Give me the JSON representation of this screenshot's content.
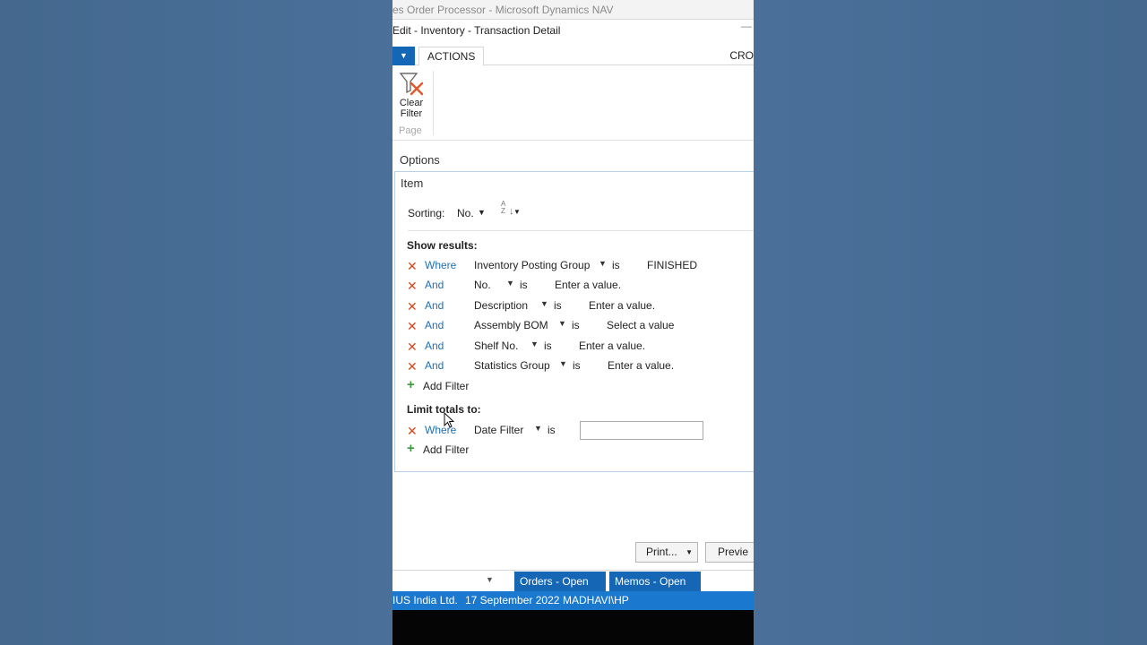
{
  "window": {
    "title": "es Order Processor - Microsoft Dynamics NAV",
    "dialog_title": "Edit - Inventory - Transaction Detail",
    "dialog_minimize": "—"
  },
  "ribbon": {
    "tabs": [
      {
        "label": "ACTIONS",
        "active": true
      },
      {
        "label": "CRO"
      }
    ],
    "clear_filter": {
      "line1": "Clear",
      "line2": "Filter"
    },
    "group_label": "Page"
  },
  "options": {
    "label": "Options",
    "item_label": "Item",
    "sorting": {
      "label": "Sorting:",
      "value": "No.",
      "dropdown_arrow": "▼",
      "direction_icon": "A Z"
    },
    "show_results": {
      "label": "Show results:",
      "filters": [
        {
          "keyword": "Where",
          "field": "Inventory Posting Group",
          "op": "is",
          "value": "FINISHED"
        },
        {
          "keyword": "And",
          "field": "No.",
          "op": "is",
          "value": "Enter a value."
        },
        {
          "keyword": "And",
          "field": "Description",
          "op": "is",
          "value": "Enter a value."
        },
        {
          "keyword": "And",
          "field": "Assembly BOM",
          "op": "is",
          "value": "Select a value"
        },
        {
          "keyword": "And",
          "field": "Shelf No.",
          "op": "is",
          "value": "Enter a value."
        },
        {
          "keyword": "And",
          "field": "Statistics Group",
          "op": "is",
          "value": "Enter a value."
        }
      ],
      "add_filter": "Add Filter"
    },
    "limit_totals": {
      "label": "Limit totals to:",
      "filters": [
        {
          "keyword": "Where",
          "field": "Date Filter",
          "op": "is",
          "value": ""
        }
      ],
      "add_filter": "Add Filter"
    }
  },
  "buttons": {
    "print": "Print...",
    "preview": "Previe"
  },
  "background_window": {
    "tiles": [
      "Orders - Open",
      "Memos - Open"
    ]
  },
  "status_bar": {
    "company": "IUS India Ltd.",
    "date": "17 September 2022",
    "user": "MADHAVI\\HP"
  },
  "colors": {
    "accent": "#1467b7",
    "status_bar": "#1a78cf",
    "remove_x": "#d24a1f",
    "link": "#1b6fb8",
    "add_plus": "#3c9a3c"
  }
}
